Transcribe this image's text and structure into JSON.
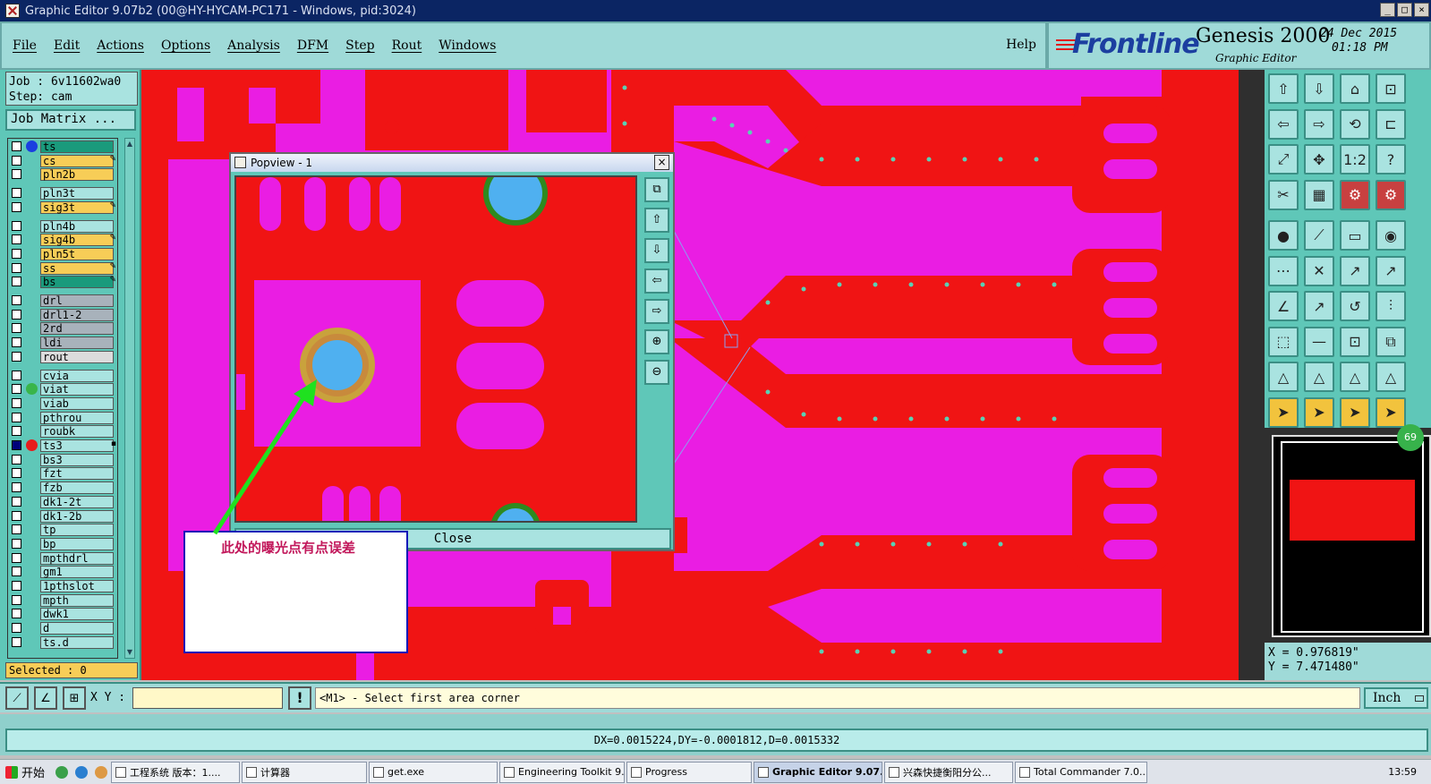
{
  "window": {
    "title": "Graphic Editor 9.07b2 (00@HY-HYCAM-PC171 - Windows, pid:3024)",
    "minimize": "_",
    "maximize": "□",
    "close": "×"
  },
  "menu": {
    "items": [
      "File",
      "Edit",
      "Actions",
      "Options",
      "Analysis",
      "DFM",
      "Step",
      "Rout",
      "Windows"
    ],
    "help": "Help"
  },
  "brand": {
    "logo": "Frontline",
    "product": "Genesis 2000",
    "subtitle": "Graphic Editor",
    "date": "24 Dec 2015",
    "time": "01:18 PM"
  },
  "job": {
    "job_line": "Job : 6v11602wa0",
    "step_line": "Step: cam",
    "matrix_button": "Job Matrix ..."
  },
  "layers": [
    {
      "name": "ts",
      "color": "#1a9a7c",
      "dot": "#1a3fe0"
    },
    {
      "name": "cs",
      "color": "#f7cd57",
      "mark": "✎"
    },
    {
      "name": "pln2b",
      "color": "#f7cd57"
    },
    {
      "name": "pln3t",
      "color": "#a9e3e0"
    },
    {
      "name": "sig3t",
      "color": "#f7cd57",
      "mark": "✎"
    },
    {
      "name": "pln4b",
      "color": "#a9e3e0"
    },
    {
      "name": "sig4b",
      "color": "#f7cd57",
      "mark": "✎"
    },
    {
      "name": "pln5t",
      "color": "#f7cd57"
    },
    {
      "name": "ss",
      "color": "#f7cd57",
      "mark": "✎"
    },
    {
      "name": "bs",
      "color": "#1a9a7c",
      "mark": "✎"
    },
    {
      "name": "drl",
      "color": "#a8b2bb"
    },
    {
      "name": "drl1-2",
      "color": "#a8b2bb"
    },
    {
      "name": "2rd",
      "color": "#a8b2bb"
    },
    {
      "name": "ldi",
      "color": "#a8b2bb"
    },
    {
      "name": "rout",
      "color": "#dcdcdc"
    },
    {
      "name": "cvia",
      "color": "#a9e3e0"
    },
    {
      "name": "viat",
      "color": "#a9e3e0",
      "dot": "#39b54a"
    },
    {
      "name": "viab",
      "color": "#a9e3e0"
    },
    {
      "name": "pthrou",
      "color": "#a9e3e0"
    },
    {
      "name": "roubk",
      "color": "#a9e3e0"
    },
    {
      "name": "ts3",
      "color": "#a9e3e0",
      "dot": "#e61c1c",
      "checked": true,
      "mark": "▪"
    },
    {
      "name": "bs3",
      "color": "#a9e3e0"
    },
    {
      "name": "fzt",
      "color": "#a9e3e0"
    },
    {
      "name": "fzb",
      "color": "#a9e3e0"
    },
    {
      "name": "dk1-2t",
      "color": "#a9e3e0"
    },
    {
      "name": "dk1-2b",
      "color": "#a9e3e0"
    },
    {
      "name": "tp",
      "color": "#a9e3e0"
    },
    {
      "name": "bp",
      "color": "#a9e3e0"
    },
    {
      "name": "mpthdrl",
      "color": "#a9e3e0"
    },
    {
      "name": "gm1",
      "color": "#a9e3e0"
    },
    {
      "name": "1pthslot",
      "color": "#a9e3e0"
    },
    {
      "name": "mpth",
      "color": "#a9e3e0"
    },
    {
      "name": "dwk1",
      "color": "#a9e3e0"
    },
    {
      "name": "d",
      "color": "#a9e3e0"
    },
    {
      "name": "ts.d",
      "color": "#a9e3e0"
    }
  ],
  "selected": "Selected : 0",
  "popview": {
    "title": "Popview - 1",
    "close_label": "Close"
  },
  "annotation": {
    "text": "此处的曝光点有点误差"
  },
  "coords": {
    "x": "X = 0.976819\"",
    "y": "Y = 7.471480\""
  },
  "minimap": {
    "badge": "69"
  },
  "command": {
    "xy_label": "X Y :",
    "warn": "!",
    "prompt": "<M1> - Select first area corner",
    "units": "Inch"
  },
  "measure": "DX=0.0015224,DY=-0.0001812,D=0.0015332",
  "taskbar": {
    "start": "开始",
    "tasks": [
      {
        "label": "工程系统  版本：1...."
      },
      {
        "label": "计算器"
      },
      {
        "label": "get.exe"
      },
      {
        "label": "Engineering Toolkit 9...."
      },
      {
        "label": "Progress"
      },
      {
        "label": "Graphic Editor 9.07...",
        "active": true
      },
      {
        "label": "兴森快捷衡阳分公..."
      },
      {
        "label": "Total Commander 7.0..."
      }
    ],
    "clock": "13:59"
  },
  "colors": {
    "canvas_bg": "#ea1de3",
    "copper": "#f01414",
    "pad_blue": "#4fb0f0",
    "annular": "#c9a23c",
    "panel": "#5fc7b8"
  }
}
